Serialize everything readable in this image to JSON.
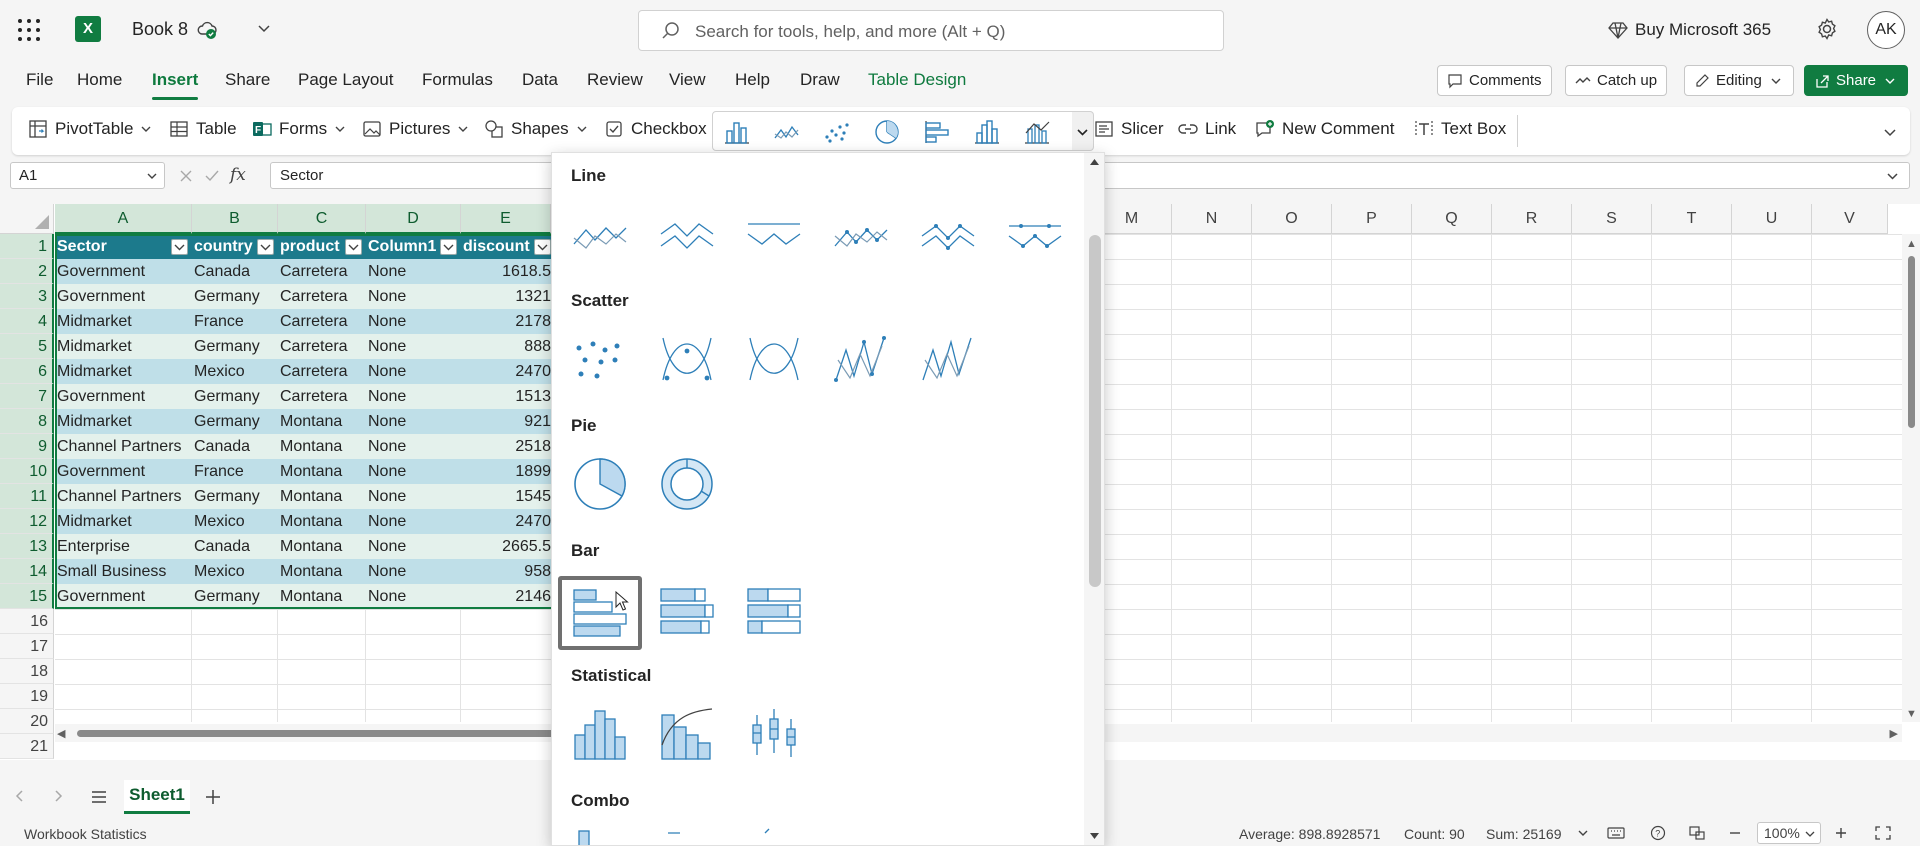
{
  "titlebar": {
    "app_icon": "excel-logo",
    "book_name": "Book 8",
    "search_placeholder": "Search for tools, help, and more (Alt + Q)",
    "buy_label": "Buy Microsoft 365",
    "avatar_initials": "AK"
  },
  "menu": {
    "tabs": [
      "File",
      "Home",
      "Insert",
      "Share",
      "Page Layout",
      "Formulas",
      "Data",
      "Review",
      "View",
      "Help",
      "Draw",
      "Table Design"
    ],
    "active_tab": "Insert",
    "comments_label": "Comments",
    "catchup_label": "Catch up",
    "editing_label": "Editing",
    "share_label": "Share"
  },
  "ribbon": {
    "pivottable": "PivotTable",
    "table": "Table",
    "forms": "Forms",
    "pictures": "Pictures",
    "shapes": "Shapes",
    "checkbox": "Checkbox",
    "slicer": "Slicer",
    "link": "Link",
    "new_comment": "New Comment",
    "text_box": "Text Box"
  },
  "formula_bar": {
    "name_box": "A1",
    "fx_symbol": "fx",
    "content": "Sector"
  },
  "grid": {
    "columns": [
      "A",
      "B",
      "C",
      "D",
      "E",
      "M",
      "N",
      "O",
      "P",
      "Q",
      "R",
      "S",
      "T",
      "U",
      "V"
    ],
    "rows": [
      "1",
      "2",
      "3",
      "4",
      "5",
      "6",
      "7",
      "8",
      "9",
      "10",
      "11",
      "12",
      "13",
      "14",
      "15",
      "16",
      "17",
      "18",
      "19",
      "20",
      "21"
    ],
    "table_headers": [
      "Sector",
      "country",
      "product",
      "Column1",
      "discount"
    ],
    "table_rows": [
      [
        "Government",
        "Canada",
        "Carretera",
        "None",
        "1618.5"
      ],
      [
        "Government",
        "Germany",
        "Carretera",
        "None",
        "1321"
      ],
      [
        "Midmarket",
        "France",
        "Carretera",
        "None",
        "2178"
      ],
      [
        "Midmarket",
        "Germany",
        "Carretera",
        "None",
        "888"
      ],
      [
        "Midmarket",
        "Mexico",
        "Carretera",
        "None",
        "2470"
      ],
      [
        "Government",
        "Germany",
        "Carretera",
        "None",
        "1513"
      ],
      [
        "Midmarket",
        "Germany",
        "Montana",
        "None",
        "921"
      ],
      [
        "Channel Partners",
        "Canada",
        "Montana",
        "None",
        "2518"
      ],
      [
        "Government",
        "France",
        "Montana",
        "None",
        "1899"
      ],
      [
        "Channel Partners",
        "Germany",
        "Montana",
        "None",
        "1545"
      ],
      [
        "Midmarket",
        "Mexico",
        "Montana",
        "None",
        "2470"
      ],
      [
        "Enterprise",
        "Canada",
        "Montana",
        "None",
        "2665.5"
      ],
      [
        "Small Business",
        "Mexico",
        "Montana",
        "None",
        "958"
      ],
      [
        "Government",
        "Germany",
        "Montana",
        "None",
        "2146"
      ]
    ]
  },
  "chart_menu": {
    "categories": [
      "Line",
      "Scatter",
      "Pie",
      "Bar",
      "Statistical",
      "Combo"
    ],
    "selected_item": "clustered-bar"
  },
  "sheets": {
    "tabs": [
      "Sheet1"
    ],
    "active": "Sheet1"
  },
  "status": {
    "workbook_stats": "Workbook Statistics",
    "average": "Average: 898.8928571",
    "count": "Count: 90",
    "sum": "Sum: 25169",
    "zoom": "100%"
  },
  "colors": {
    "accent_green": "#107c41",
    "table_header": "#1c7a8c",
    "table_band": "#bfdfe8",
    "chart_icon_blue": "#2e7fb8"
  }
}
